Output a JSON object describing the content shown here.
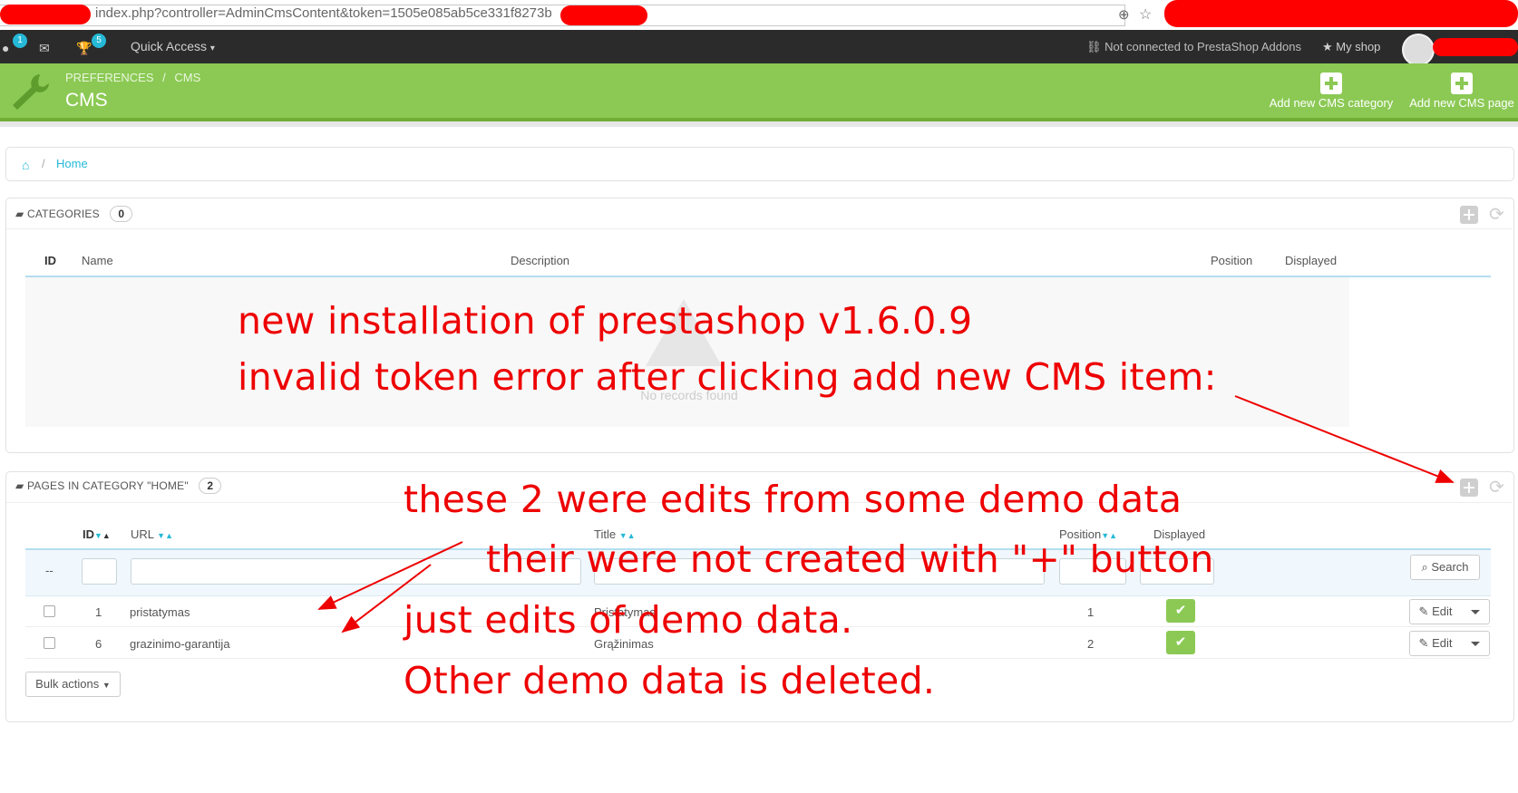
{
  "browser": {
    "url": "index.php?controller=AdminCmsContent&token=1505e085ab5ce331f8273b",
    "zoom_icon": "zoom-icon",
    "star_icon": "bookmark-star-icon"
  },
  "topnav": {
    "customers_badge": "1",
    "trophy_badge": "5",
    "quick_access": "Quick Access",
    "not_connected": "Not connected to PrestaShop Addons",
    "my_shop": "My shop"
  },
  "header": {
    "breadcrumb_1": "PREFERENCES",
    "breadcrumb_sep": "/",
    "breadcrumb_2": "CMS",
    "title": "CMS",
    "add_category": "Add new CMS category",
    "add_page": "Add new CMS page",
    "accent": "#8bc954"
  },
  "breadcrumb": {
    "home": "Home",
    "sep": "/"
  },
  "categories": {
    "title": "CATEGORIES",
    "count": "0",
    "columns": {
      "id": "ID",
      "name": "Name",
      "description": "Description",
      "position": "Position",
      "displayed": "Displayed"
    },
    "empty_text": "No records found"
  },
  "pages": {
    "title": "PAGES IN CATEGORY \"HOME\"",
    "count": "2",
    "columns": {
      "id": "ID",
      "url": "URL",
      "title": "Title",
      "position": "Position",
      "displayed": "Displayed"
    },
    "filter_dash": "--",
    "search": "Search",
    "rows": [
      {
        "id": "1",
        "url": "pristatymas",
        "title": "Pristatymas",
        "position": "1",
        "edit": "Edit"
      },
      {
        "id": "6",
        "url": "grazinimo-garantija",
        "title": "Grąžinimas",
        "position": "2",
        "edit": "Edit"
      }
    ],
    "bulk_actions": "Bulk actions"
  },
  "annotations": {
    "line1": "new installation of prestashop v1.6.0.9",
    "line2": "invalid token error after clicking add new CMS item:",
    "line3": "these 2  were edits from some demo data",
    "line4": "their were not created with \"+\" button",
    "line5": "just edits of demo data.",
    "line6": "Other demo data is deleted.",
    "color": "#e00000"
  }
}
